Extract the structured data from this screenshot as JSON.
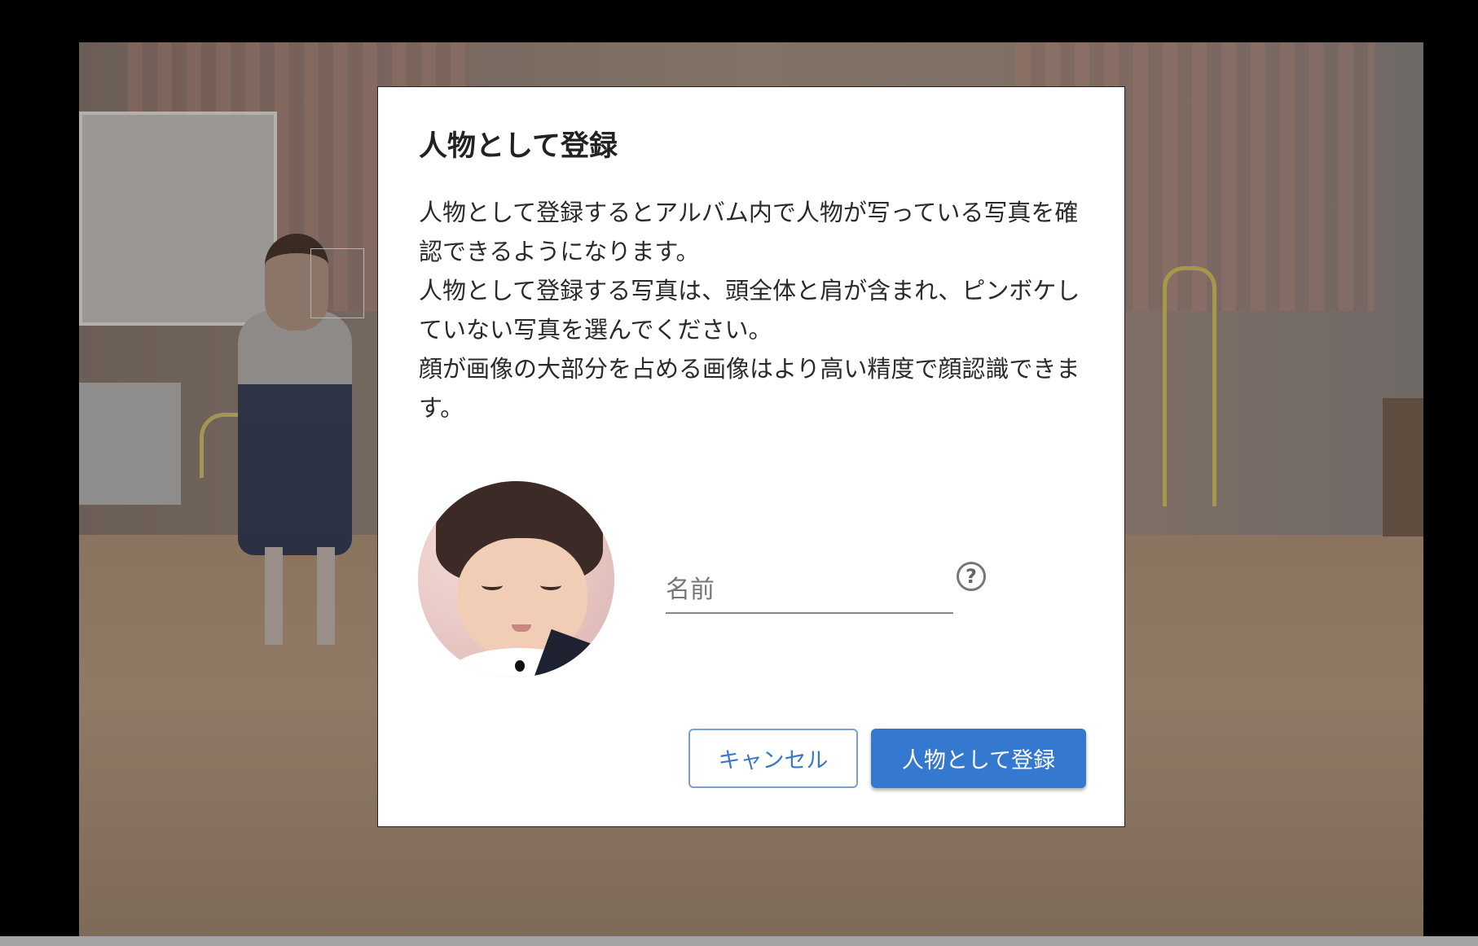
{
  "dialog": {
    "title": "人物として登録",
    "description": [
      "人物として登録するとアルバム内で人物が写っている写真を確認できるようになります。",
      "人物として登録する写真は、頭全体と肩が含まれ、ピンボケしていない写真を選んでください。",
      "顔が画像の大部分を占める画像はより高い精度で顔認識できます。"
    ],
    "name_field": {
      "placeholder": "名前",
      "value": ""
    },
    "help_icon": "question-circle-icon",
    "help_glyph": "?",
    "buttons": {
      "cancel_label": "キャンセル",
      "register_label": "人物として登録"
    }
  },
  "colors": {
    "primary": "#3478cf",
    "cancel_text": "#3a78c4",
    "overlay_bottom_bar": "#a4a4a4"
  }
}
